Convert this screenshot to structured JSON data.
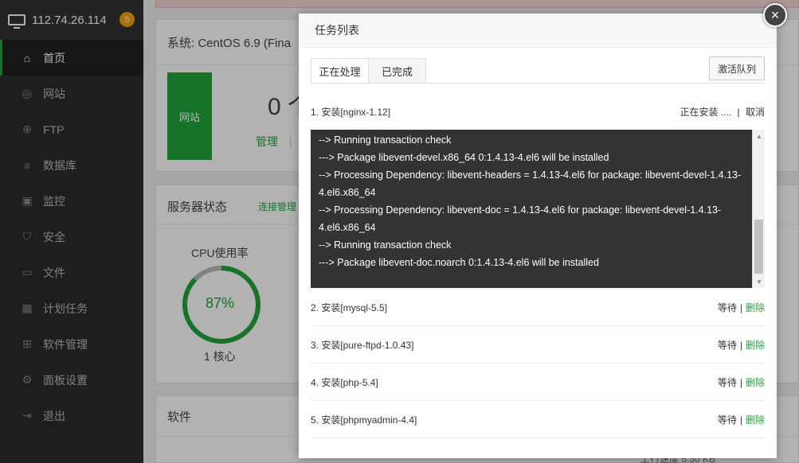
{
  "sidebar": {
    "ip": "112.74.26.114",
    "badge": "5",
    "items": [
      {
        "label": "首页",
        "icon": "home-icon",
        "glyph": "⌂"
      },
      {
        "label": "网站",
        "icon": "globe-icon",
        "glyph": "◎"
      },
      {
        "label": "FTP",
        "icon": "ftp-icon",
        "glyph": "⊕"
      },
      {
        "label": "数据库",
        "icon": "database-icon",
        "glyph": "≡"
      },
      {
        "label": "监控",
        "icon": "monitor-icon",
        "glyph": "▣"
      },
      {
        "label": "安全",
        "icon": "shield-icon",
        "glyph": "⛉"
      },
      {
        "label": "文件",
        "icon": "folder-icon",
        "glyph": "▭"
      },
      {
        "label": "计划任务",
        "icon": "calendar-icon",
        "glyph": "▦"
      },
      {
        "label": "软件管理",
        "icon": "apps-icon",
        "glyph": "⊞"
      },
      {
        "label": "面板设置",
        "icon": "gear-icon",
        "glyph": "⚙"
      },
      {
        "label": "退出",
        "icon": "logout-icon",
        "glyph": "⇥"
      }
    ]
  },
  "main": {
    "system": "系统: CentOS 6.9 (Fina",
    "site_tile": "网站",
    "site_count": "0 个",
    "manage_link": "管理",
    "manage_sep": "|",
    "server_status": "服务器状态",
    "connect_link": "连接管理",
    "cpu_title": "CPU使用率",
    "cpu_value": "87%",
    "cpu_fraction": 0.87,
    "cores": "1 核心",
    "software_title": "软件",
    "speed": "上行速度 5.30 KB"
  },
  "modal": {
    "title": "任务列表",
    "close": "×",
    "tabs": [
      "正在处理",
      "已完成"
    ],
    "activate_button": "激活队列",
    "current_task": {
      "name": "1. 安装[nginx-1.12]",
      "status": "正在安装 ....",
      "sep": "|",
      "cancel": "取消"
    },
    "log_lines": [
      "--> Running transaction check",
      "---> Package libevent-devel.x86_64 0:1.4.13-4.el6 will be installed",
      "--> Processing Dependency: libevent-headers = 1.4.13-4.el6 for package: libevent-devel-1.4.13-4.el6.x86_64",
      "--> Processing Dependency: libevent-doc = 1.4.13-4.el6 for package: libevent-devel-1.4.13-4.el6.x86_64",
      "--> Running transaction check",
      "---> Package libevent-doc.noarch 0:1.4.13-4.el6 will be installed"
    ],
    "queued": [
      {
        "name": "2. 安装[mysql-5.5]",
        "status": "等待",
        "sep": "|",
        "action": "删除"
      },
      {
        "name": "3. 安装[pure-ftpd-1.0.43]",
        "status": "等待",
        "sep": "|",
        "action": "删除"
      },
      {
        "name": "4. 安装[php-5.4]",
        "status": "等待",
        "sep": "|",
        "action": "删除"
      },
      {
        "name": "5. 安装[phpmyadmin-4.4]",
        "status": "等待",
        "sep": "|",
        "action": "删除"
      }
    ]
  },
  "colors": {
    "accent": "#20a53a",
    "sidebar": "#2c2c2c",
    "badge": "#f0a30a",
    "log_bg": "#333333"
  }
}
